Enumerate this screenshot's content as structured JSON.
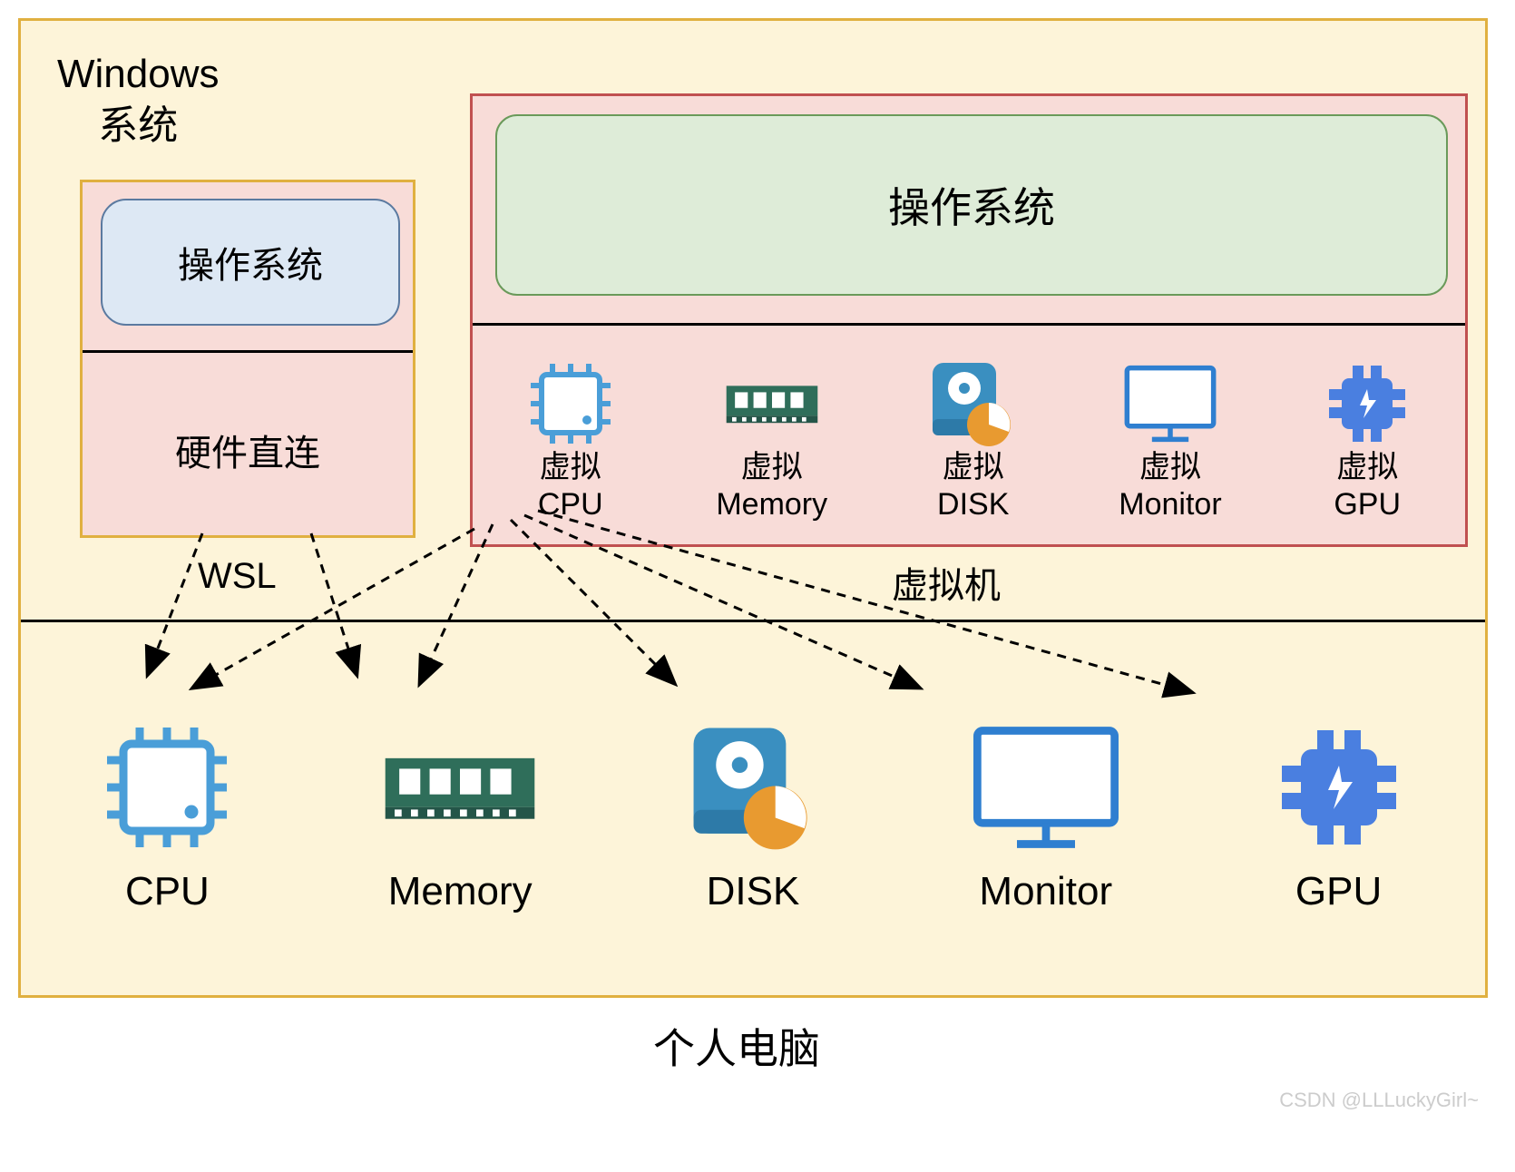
{
  "windows_title_line1": "Windows",
  "windows_title_line2": "系统",
  "wsl": {
    "os_label": "操作系统",
    "hw_label": "硬件直连",
    "caption": "WSL"
  },
  "vm": {
    "os_label": "操作系统",
    "caption": "虚拟机",
    "items": [
      {
        "line1": "虚拟",
        "line2": "CPU",
        "icon": "cpu"
      },
      {
        "line1": "虚拟",
        "line2": "Memory",
        "icon": "memory"
      },
      {
        "line1": "虚拟",
        "line2": "DISK",
        "icon": "disk"
      },
      {
        "line1": "虚拟",
        "line2": "Monitor",
        "icon": "monitor"
      },
      {
        "line1": "虚拟",
        "line2": "GPU",
        "icon": "gpu"
      }
    ]
  },
  "pc": {
    "caption": "个人电脑",
    "items": [
      {
        "label": "CPU",
        "icon": "cpu"
      },
      {
        "label": "Memory",
        "icon": "memory"
      },
      {
        "label": "DISK",
        "icon": "disk"
      },
      {
        "label": "Monitor",
        "icon": "monitor"
      },
      {
        "label": "GPU",
        "icon": "gpu"
      }
    ]
  },
  "watermark": "CSDN @LLLuckyGirl~",
  "colors": {
    "cpu": "#4a9ed8",
    "memory": "#2f6e5a",
    "disk_body": "#3a8fc0",
    "disk_pie": "#e89a30",
    "monitor": "#2f7fd0",
    "gpu": "#4a7fe0"
  },
  "diagram_semantics": {
    "description": "Comparison of WSL vs Virtual Machine on a Windows system inside a personal computer. WSL operating system connects directly to physical hardware (硬件直连). Virtual machine operating system runs on virtualized hardware (虚拟CPU/Memory/DISK/Monitor/GPU) which in turn maps to the physical hardware.",
    "arrows": [
      {
        "from": "WSL 硬件直连",
        "to": "CPU (physical)"
      },
      {
        "from": "WSL 硬件直连",
        "to": "Memory (physical)"
      },
      {
        "from": "虚拟机 (VM box)",
        "to": "CPU (physical)"
      },
      {
        "from": "虚拟机 (VM box)",
        "to": "Memory (physical)"
      },
      {
        "from": "虚拟机 (VM box)",
        "to": "DISK (physical)"
      },
      {
        "from": "虚拟机 (VM box)",
        "to": "Monitor (physical)"
      },
      {
        "from": "虚拟机 (VM box)",
        "to": "GPU (physical)"
      }
    ]
  }
}
